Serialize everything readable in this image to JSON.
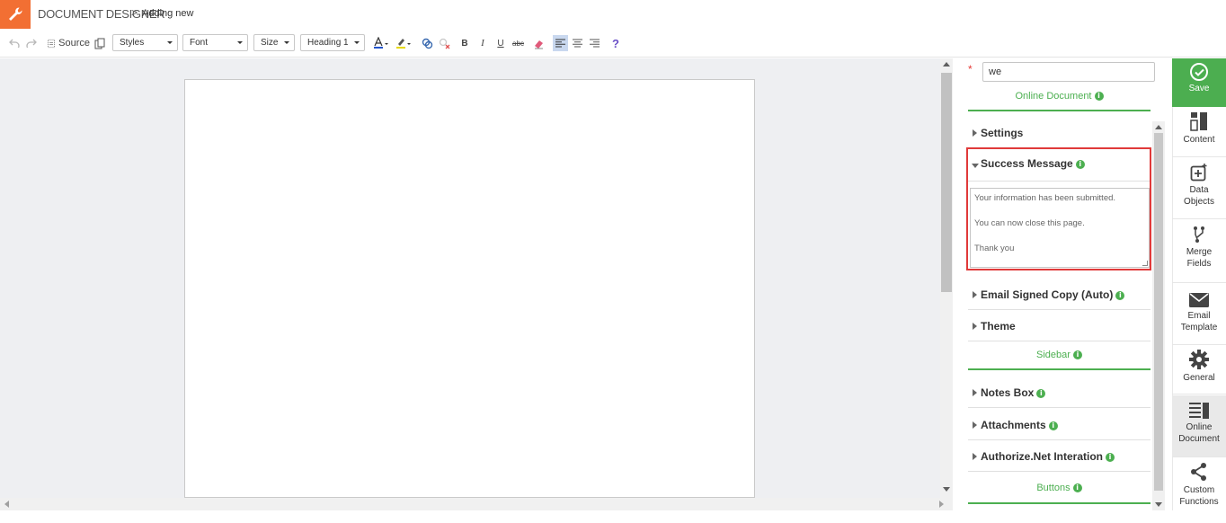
{
  "header": {
    "app_title": "DOCUMENT DESIGNER",
    "breadcrumb_sep": ">",
    "breadcrumb_current": "Adding new"
  },
  "toolbar": {
    "source_label": "Source",
    "styles_label": "Styles",
    "font_label": "Font",
    "size_label": "Size",
    "format_label": "Heading 1",
    "bold_label": "B",
    "italic_label": "I",
    "underline_label": "U",
    "strike_label": "abc",
    "help_label": "?"
  },
  "panel": {
    "name_value": "we",
    "required_mark": "*",
    "online_document_title": "Online Document",
    "settings_label": "Settings",
    "success_message_label": "Success Message",
    "success_message_lines": [
      "Your information has been submitted.",
      "You can now close this page.",
      "Thank you"
    ],
    "email_signed_copy_label": "Email Signed Copy (Auto)",
    "theme_label": "Theme",
    "sidebar_title": "Sidebar",
    "notes_box_label": "Notes Box",
    "attachments_label": "Attachments",
    "authorize_label": "Authorize.Net Interation",
    "buttons_title": "Buttons",
    "info_glyph": "i"
  },
  "rail": {
    "save": "Save",
    "content": "Content",
    "data_objects_1": "Data",
    "data_objects_2": "Objects",
    "merge_fields_1": "Merge",
    "merge_fields_2": "Fields",
    "email_template_1": "Email",
    "email_template_2": "Template",
    "general": "General",
    "online_document_1": "Online",
    "online_document_2": "Document",
    "custom_functions_1": "Custom",
    "custom_functions_2": "Functions"
  },
  "colors": {
    "brand_orange": "#f26f33",
    "accent_green": "#4caf50",
    "highlight_red": "#e03a3a"
  }
}
